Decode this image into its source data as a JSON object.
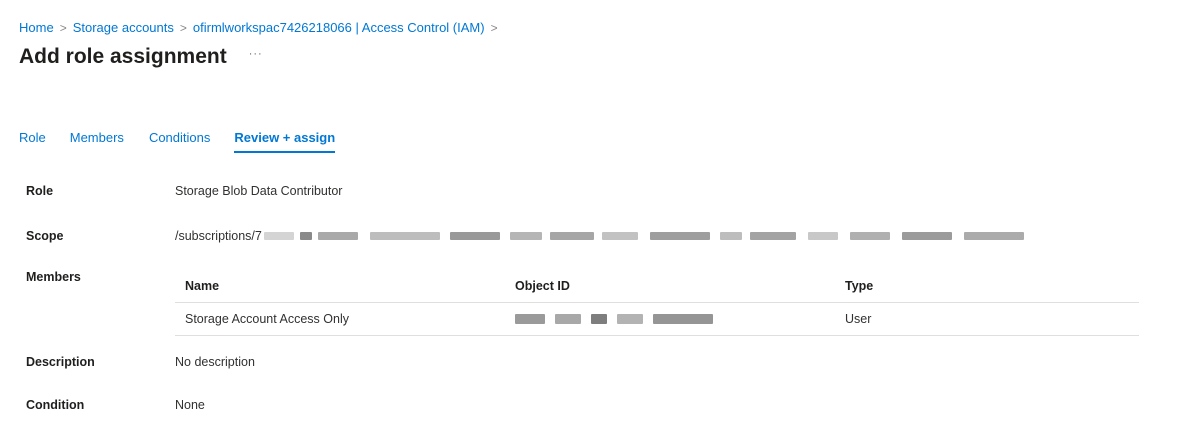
{
  "breadcrumb": {
    "items": [
      "Home",
      "Storage accounts",
      "ofirmlworkspac7426218066 | Access Control (IAM)"
    ],
    "separator": ">"
  },
  "page": {
    "title": "Add role assignment",
    "more_label": "···"
  },
  "tabs": [
    {
      "label": "Role"
    },
    {
      "label": "Members"
    },
    {
      "label": "Conditions"
    },
    {
      "label": "Review + assign"
    }
  ],
  "review": {
    "role_label": "Role",
    "role_value": "Storage Blob Data Contributor",
    "scope_label": "Scope",
    "scope_value": "/subscriptions/7",
    "members_label": "Members",
    "members_table": {
      "columns": [
        "Name",
        "Object ID",
        "Type"
      ],
      "rows": [
        {
          "name": "Storage Account Access Only",
          "type": "User"
        }
      ]
    },
    "description_label": "Description",
    "description_value": "No description",
    "condition_label": "Condition",
    "condition_value": "None"
  },
  "colors": {
    "accent": "#0078d4",
    "text": "#323130",
    "border": "#e1dfdd"
  }
}
